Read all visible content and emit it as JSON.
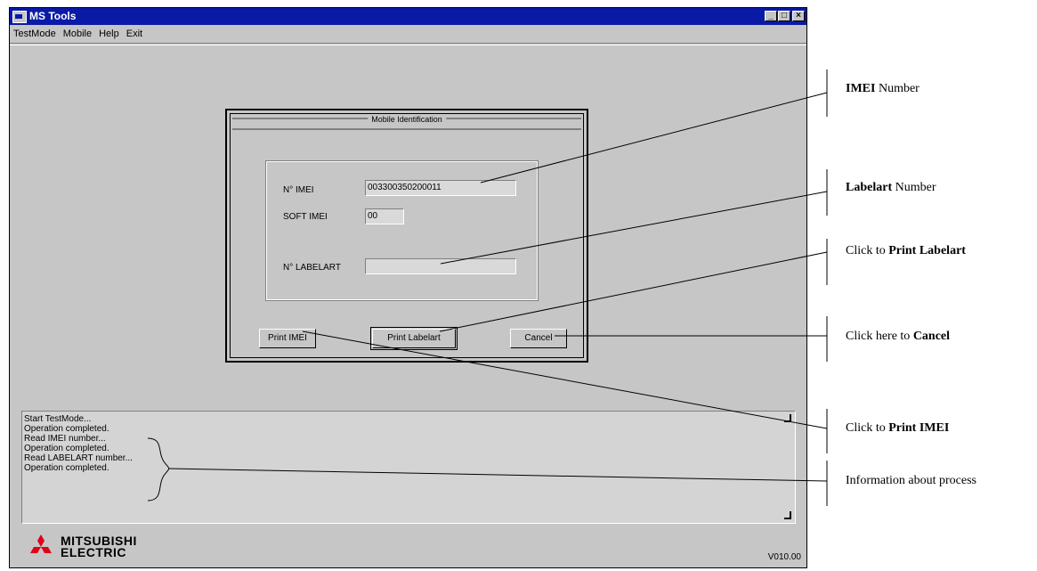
{
  "window": {
    "title": "MS Tools",
    "menu": [
      "TestMode",
      "Mobile",
      "Help",
      "Exit"
    ],
    "min_glyph": "_",
    "max_glyph": "□",
    "close_glyph": "×"
  },
  "dialog": {
    "title": "Mobile Identification",
    "imei_label": "N° IMEI",
    "imei_value": "003300350200011",
    "soft_imei_label": "SOFT IMEI",
    "soft_imei_value": "00",
    "labelart_label": "N° LABELART",
    "labelart_value": "",
    "print_imei_button": "Print IMEI",
    "print_labelart_button": "Print Labelart",
    "cancel_button": "Cancel"
  },
  "log": {
    "lines": [
      "Start TestMode...",
      "Operation completed.",
      "Read IMEI number...",
      "Operation completed.",
      "Read LABELART number...",
      "Operation completed."
    ]
  },
  "brand": {
    "logo_line1": "MITSUBISHI",
    "logo_line2": "ELECTRIC",
    "logo_color": "#e0001a"
  },
  "version": "V010.00",
  "annotations": {
    "imei": {
      "bold": "IMEI",
      "rest": "Number"
    },
    "labelart": {
      "bold": "Labelart",
      "rest": "Number"
    },
    "print_labelart": {
      "pre": "Click to",
      "bold": "Print Labelart"
    },
    "cancel": {
      "pre": "Click here to",
      "bold": "Cancel"
    },
    "print_imei": {
      "pre": "Click to",
      "bold": "Print IMEI"
    },
    "process": {
      "pre": "Information about process"
    }
  }
}
